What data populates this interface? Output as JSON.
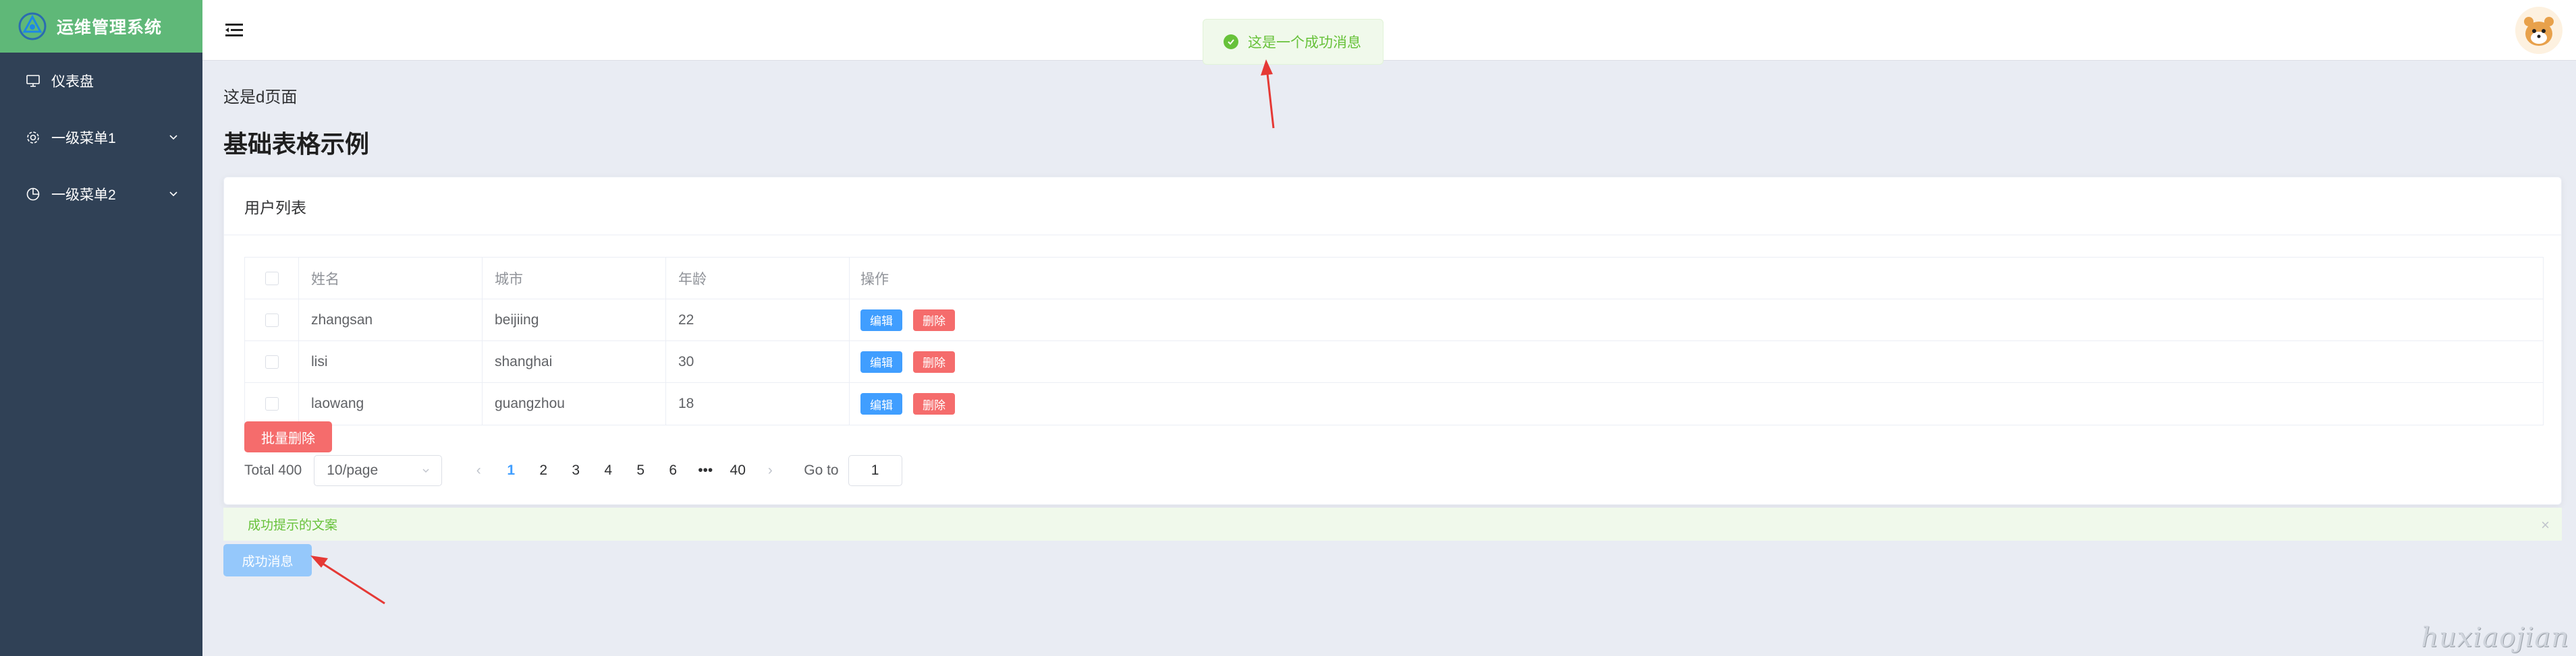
{
  "app": {
    "title": "运维管理系统"
  },
  "sidebar": {
    "items": [
      {
        "label": "仪表盘",
        "icon": "monitor-icon"
      },
      {
        "label": "一级菜单1",
        "icon": "gear-icon"
      },
      {
        "label": "一级菜单2",
        "icon": "pie-chart-icon"
      }
    ]
  },
  "toast": {
    "message": "这是一个成功消息"
  },
  "main": {
    "breadcrumb": "这是d页面",
    "title": "基础表格示例",
    "card_title": "用户列表"
  },
  "table": {
    "columns": [
      "姓名",
      "城市",
      "年龄",
      "操作"
    ],
    "rows": [
      {
        "name": "zhangsan",
        "city": "beijiing",
        "age": "22"
      },
      {
        "name": "lisi",
        "city": "shanghai",
        "age": "30"
      },
      {
        "name": "laowang",
        "city": "guangzhou",
        "age": "18"
      }
    ],
    "edit_label": "编辑",
    "delete_label": "删除"
  },
  "batch_delete_label": "批量删除",
  "pagination": {
    "total": "Total 400",
    "page_size": "10/page",
    "pages": [
      "1",
      "2",
      "3",
      "4",
      "5",
      "6",
      "•••",
      "40"
    ],
    "current": "1",
    "goto_label": "Go to",
    "goto_value": "1"
  },
  "alert": {
    "text": "成功提示的文案",
    "close": "×"
  },
  "success_button_label": "成功消息",
  "watermark": "huxiaojian",
  "colors": {
    "sidebar_bg": "#304156",
    "logo_bar": "#5fb878",
    "primary": "#409eff",
    "danger": "#f56c6c",
    "success": "#67c23a"
  }
}
